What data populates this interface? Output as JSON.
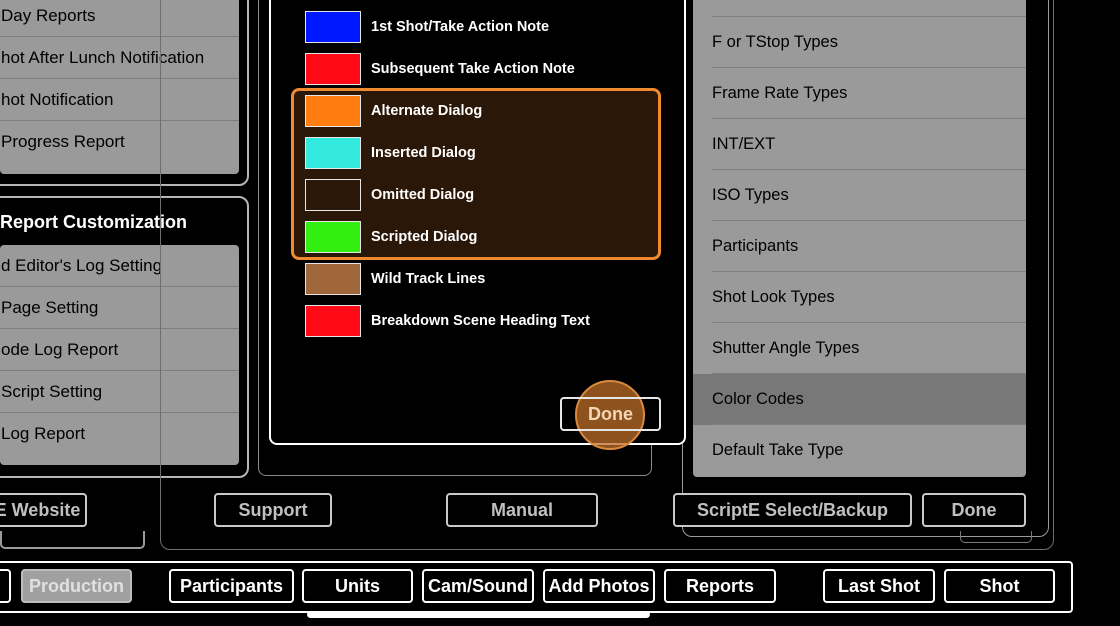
{
  "left": {
    "reports_items": [
      "Day Reports",
      "hot After Lunch Notification",
      "hot Notification",
      "Progress Report"
    ],
    "customization_title": "Report Customization",
    "customization_items": [
      "d Editor's Log Setting",
      "Page Setting",
      "ode Log Report",
      "Script Setting",
      "Log Report"
    ]
  },
  "modal": {
    "colors": [
      {
        "label": "1st Shot/Take Action Note",
        "color": "#0018ff"
      },
      {
        "label": "Subsequent Take Action Note",
        "color": "#ff0a16"
      },
      {
        "label": "Alternate Dialog",
        "color": "#ff7d10"
      },
      {
        "label": "Inserted Dialog",
        "color": "#33e8dc"
      },
      {
        "label": "Omitted Dialog",
        "color": "#2b1708"
      },
      {
        "label": "Scripted Dialog",
        "color": "#33ee11"
      },
      {
        "label": "Wild Track Lines",
        "color": "#a0683a"
      },
      {
        "label": "Breakdown Scene Heading Text",
        "color": "#ff0a16"
      }
    ],
    "done_label": "Done",
    "highlight_color": "#f08a30"
  },
  "right": {
    "items": [
      "F or TStop Types",
      "Frame Rate Types",
      "INT/EXT",
      "ISO Types",
      "Participants",
      "Shot Look Types",
      "Shutter Angle Types",
      "Color Codes",
      "Default Take Type"
    ],
    "selected": "Color Codes"
  },
  "bottom_bar": {
    "website_label": "E Website",
    "support_label": "Support",
    "manual_label": "Manual",
    "select_backup_label": "ScriptE Select/Backup",
    "done_label": "Done"
  },
  "tabs": {
    "production": "Production",
    "participants": "Participants",
    "units": "Units",
    "cam_sound": "Cam/Sound",
    "add_photos": "Add Photos",
    "reports": "Reports",
    "last_shot": "Last Shot",
    "shot": "Shot"
  }
}
